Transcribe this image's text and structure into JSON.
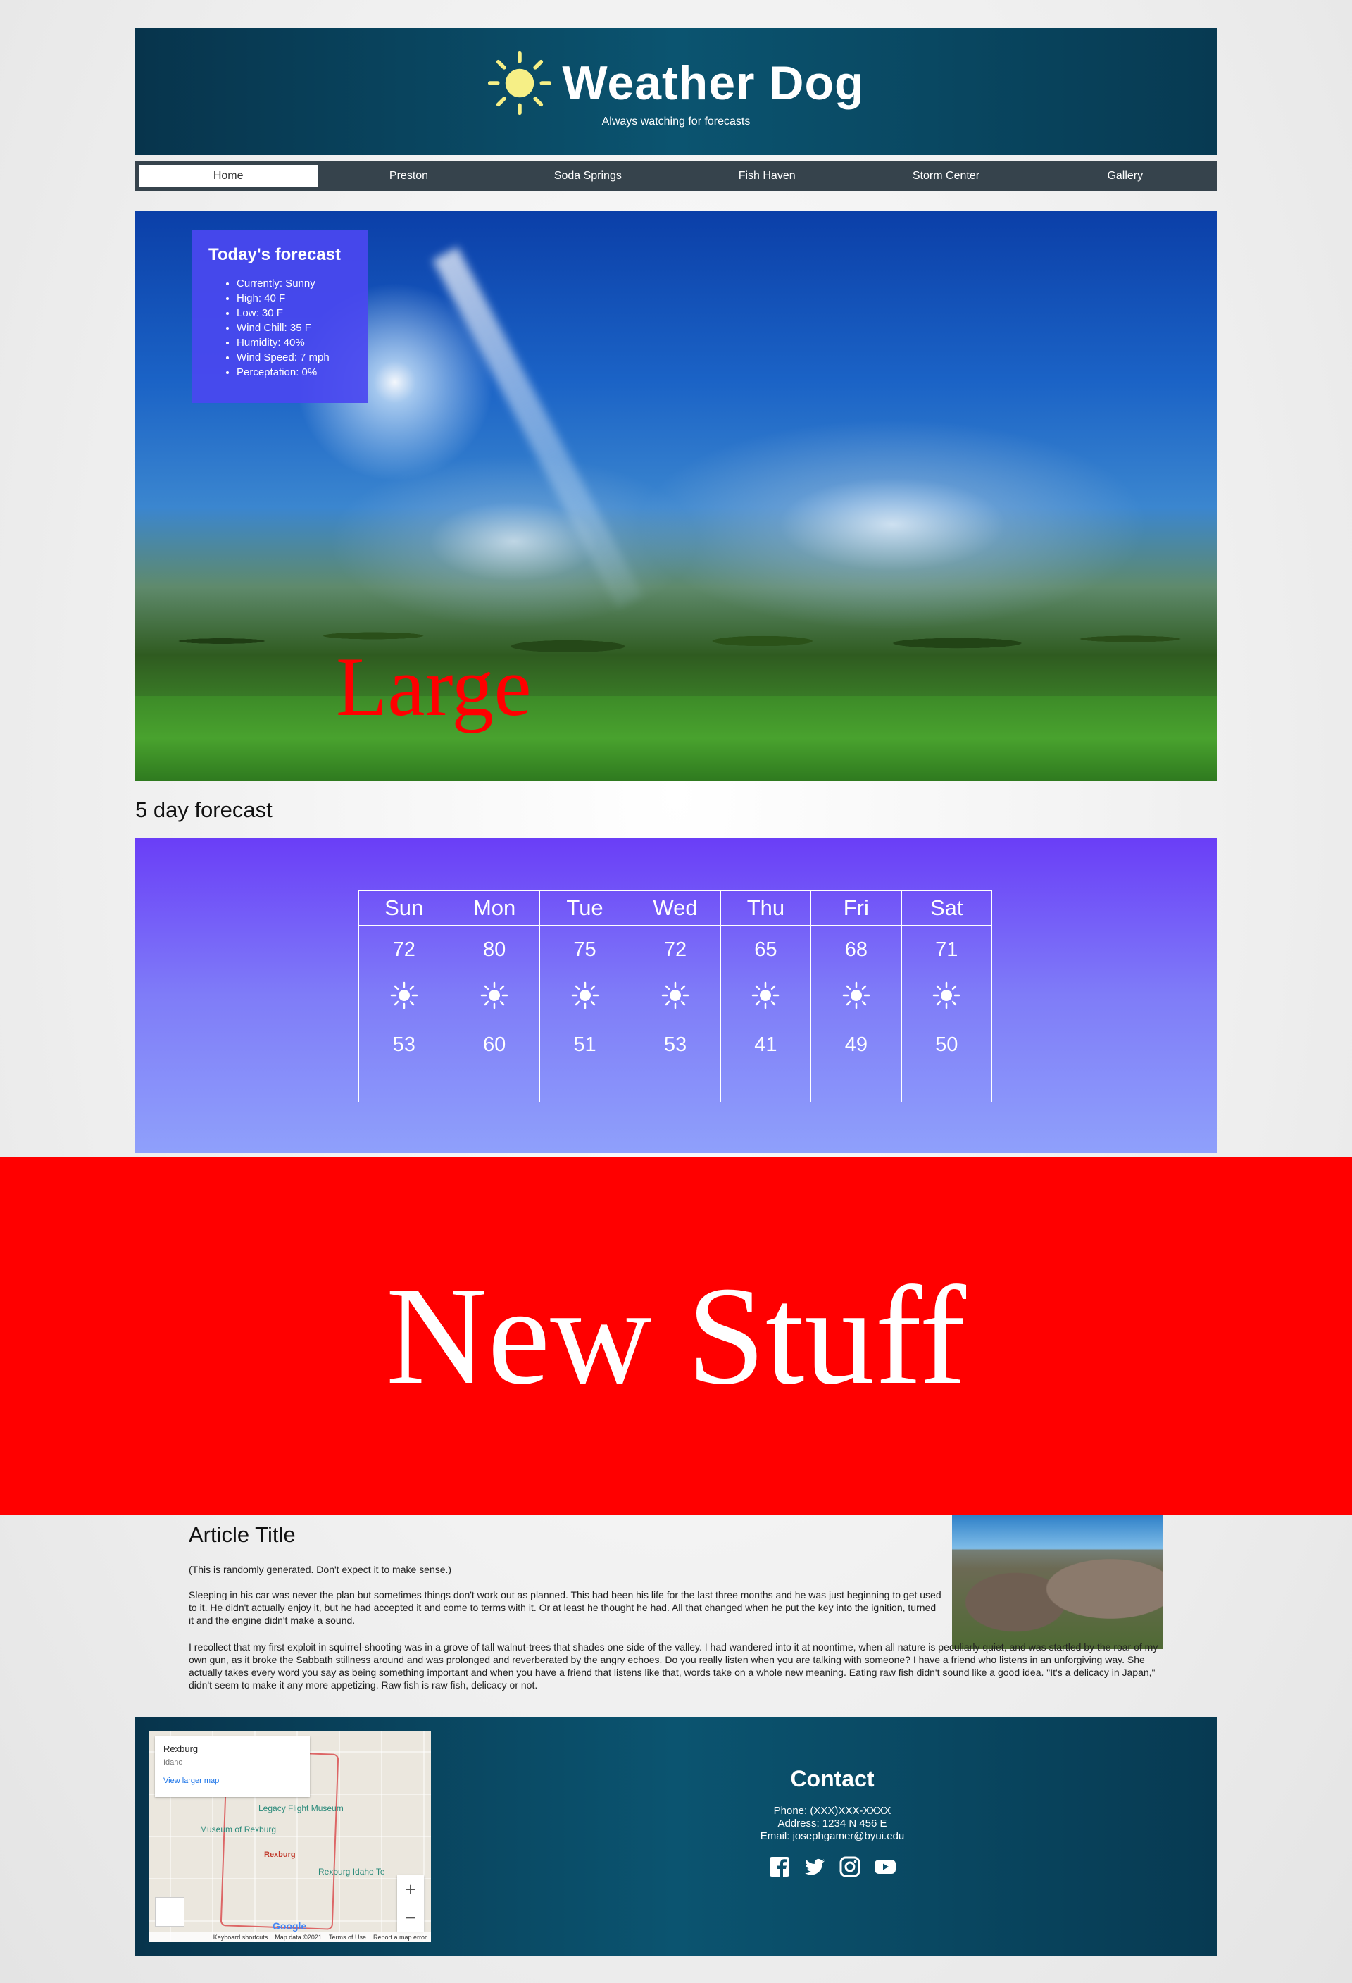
{
  "header": {
    "title": "Weather Dog",
    "tagline": "Always watching for forecasts"
  },
  "nav": {
    "items": [
      "Home",
      "Preston",
      "Soda Springs",
      "Fish Haven",
      "Storm Center",
      "Gallery"
    ]
  },
  "forecast_card": {
    "title": "Today's forecast",
    "items": [
      "Currently: Sunny",
      "High: 40 F",
      "Low: 30 F",
      "Wind Chill: 35 F",
      "Humidity: 40%",
      "Wind Speed: 7 mph",
      "Perceptation: 0%"
    ]
  },
  "hero": {
    "overlay_text": "Large"
  },
  "five_day": {
    "heading": "5 day forecast",
    "days": [
      {
        "day": "Sun",
        "high": "72",
        "low": "53",
        "icon": "sun-icon"
      },
      {
        "day": "Mon",
        "high": "80",
        "low": "60",
        "icon": "sun-icon"
      },
      {
        "day": "Tue",
        "high": "75",
        "low": "51",
        "icon": "sun-icon"
      },
      {
        "day": "Wed",
        "high": "72",
        "low": "53",
        "icon": "sun-icon"
      },
      {
        "day": "Thu",
        "high": "65",
        "low": "41",
        "icon": "sun-icon"
      },
      {
        "day": "Fri",
        "high": "68",
        "low": "49",
        "icon": "sun-icon"
      },
      {
        "day": "Sat",
        "high": "71",
        "low": "50",
        "icon": "sun-icon"
      }
    ]
  },
  "banner": {
    "text": "New Stuff"
  },
  "article": {
    "title": "Article Title",
    "note": "(This is randomly generated. Don't expect it to make sense.)",
    "p1": "Sleeping in his car was never the plan but sometimes things don't work out as planned. This had been his life for the last three months and he was just beginning to get used to it. He didn't actually enjoy it, but he had accepted it and come to terms with it. Or at least he thought he had. All that changed when he put the key into the ignition, turned it and the engine didn't make a sound.",
    "p2": "I recollect that my first exploit in squirrel-shooting was in a grove of tall walnut-trees that shades one side of the valley. I had wandered into it at noontime, when all nature is peculiarly quiet, and was startled by the roar of my own gun, as it broke the Sabbath stillness around and was prolonged and reverberated by the angry echoes. Do you really listen when you are talking with someone? I have a friend who listens in an unforgiving way. She actually takes every word you say as being something important and when you have a friend that listens like that, words take on a whole new meaning. Eating raw fish didn't sound like a good idea. \"It's a delicacy in Japan,\" didn't seem to make it any more appetizing. Raw fish is raw fish, delicacy or not."
  },
  "map": {
    "place": "Rexburg",
    "region": "Idaho",
    "link": "View larger map",
    "labels": [
      "Legacy Flight Museum",
      "Museum of Rexburg",
      "Rexburg",
      "Rexburg Idaho Te"
    ],
    "zoom_in": "+",
    "zoom_out": "−",
    "logo": "Google",
    "attribution": [
      "Keyboard shortcuts",
      "Map data ©2021",
      "Terms of Use",
      "Report a map error"
    ]
  },
  "contact": {
    "title": "Contact",
    "phone": "Phone: (XXX)XXX-XXXX",
    "address": "Address: 1234 N 456 E",
    "email": "Email: josephgamer@byui.edu",
    "socials": [
      "facebook-icon",
      "twitter-icon",
      "instagram-icon",
      "youtube-icon"
    ]
  },
  "colors": {
    "header_bg": "#07344c",
    "nav_bg": "#36434c",
    "card_bg": "#4a48f0",
    "banner_bg": "#ff0000",
    "large_text": "#ff0000"
  }
}
